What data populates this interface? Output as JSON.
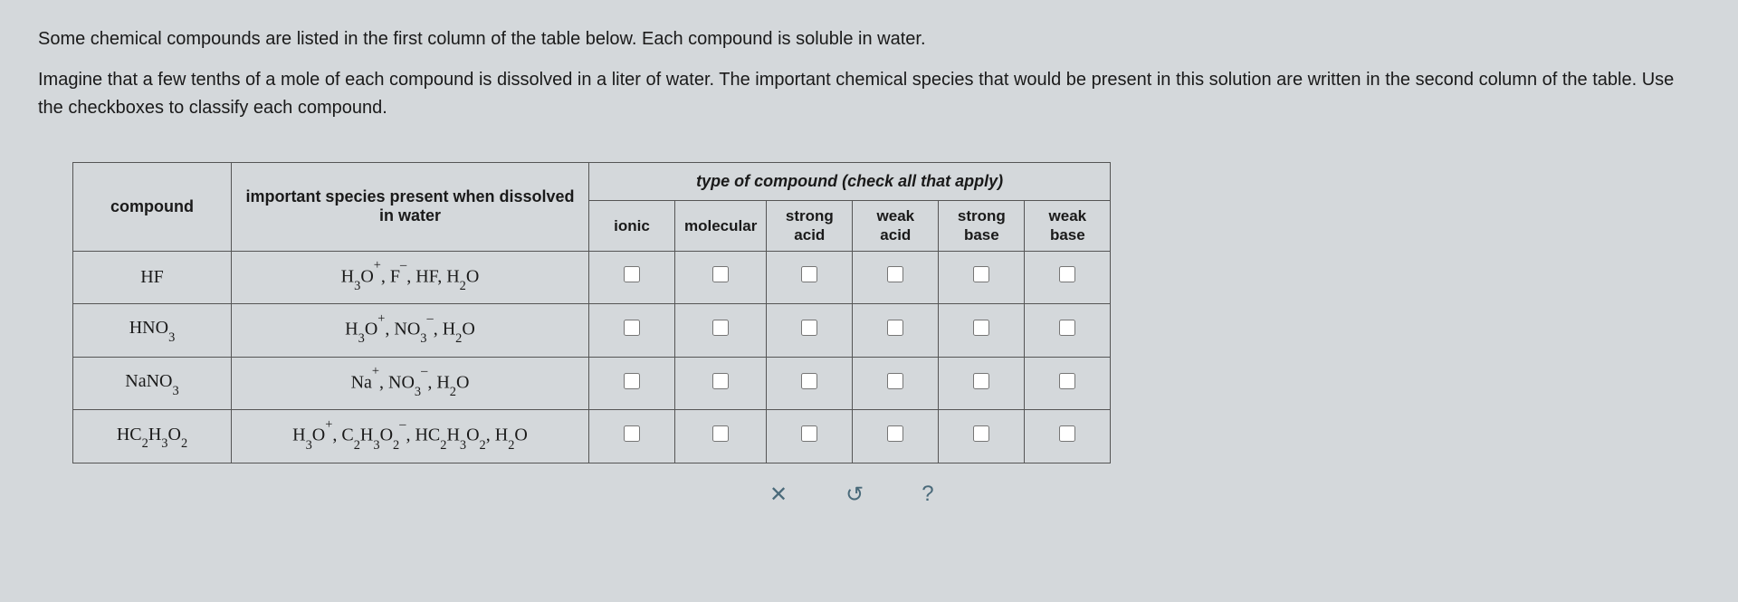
{
  "instructions": {
    "p1": "Some chemical compounds are listed in the first column of the table below. Each compound is soluble in water.",
    "p2": "Imagine that a few tenths of a mole of each compound is dissolved in a liter of water. The important chemical species that would be present in this solution are written in the second column of the table. Use the checkboxes to classify each compound."
  },
  "headers": {
    "compound": "compound",
    "species": "important species present when dissolved in water",
    "type_group": "type of compound (check all that apply)",
    "ionic": "ionic",
    "molecular": "molecular",
    "strong_acid_l1": "strong",
    "strong_acid_l2": "acid",
    "weak_acid_l1": "weak",
    "weak_acid_l2": "acid",
    "strong_base_l1": "strong",
    "strong_base_l2": "base",
    "weak_base_l1": "weak",
    "weak_base_l2": "base"
  },
  "rows": [
    {
      "compound_html": "HF",
      "species_html": "H<sub>3</sub>O<sup>+</sup>, F<sup>&#8211;</sup>, HF, H<sub>2</sub>O"
    },
    {
      "compound_html": "HNO<sub>3</sub>",
      "species_html": "H<sub>3</sub>O<sup>+</sup>, NO<sub>3</sub><sup>&#8211;</sup>, H<sub>2</sub>O"
    },
    {
      "compound_html": "NaNO<sub>3</sub>",
      "species_html": "Na<sup>+</sup>, NO<sub>3</sub><sup>&#8211;</sup>, H<sub>2</sub>O"
    },
    {
      "compound_html": "HC<sub>2</sub>H<sub>3</sub>O<sub>2</sub>",
      "species_html": "H<sub>3</sub>O<sup>+</sup>, C<sub>2</sub>H<sub>3</sub>O<sub>2</sub><sup>&#8211;</sup>, HC<sub>2</sub>H<sub>3</sub>O<sub>2</sub>, H<sub>2</sub>O"
    }
  ],
  "footer": {
    "clear": "✕",
    "reset": "↺",
    "help": "?"
  }
}
